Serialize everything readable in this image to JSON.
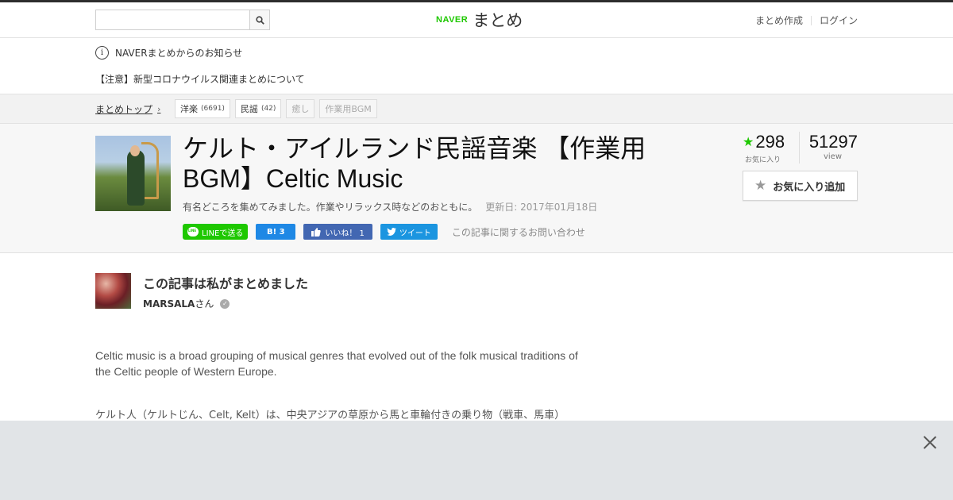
{
  "header": {
    "search": {
      "value": "",
      "placeholder": ""
    },
    "logo": {
      "brand": "NAVER",
      "product": "まとめ"
    },
    "links": {
      "create": "まとめ作成",
      "login": "ログイン"
    }
  },
  "notice": {
    "title": "NAVERまとめからのお知らせ",
    "link": "【注意】新型コロナウイルス関連まとめについて"
  },
  "breadcrumb": {
    "top": "まとめトップ",
    "tags": [
      {
        "label": "洋楽",
        "count": "(6691)"
      },
      {
        "label": "民謡",
        "count": "(42)"
      },
      {
        "label": "癒し",
        "count": ""
      },
      {
        "label": "作業用BGM",
        "count": ""
      }
    ]
  },
  "article": {
    "title": "ケルト・アイルランド民謡音楽 【作業用BGM】Celtic Music",
    "description": "有名どころを集めてみました。作業やリラックス時などのおともに。",
    "updated": "更新日: 2017年01月18日",
    "favorites": "298",
    "favorites_label": "お気に入り",
    "views": "51297",
    "views_label": "view",
    "fav_button": "お気に入り追加"
  },
  "share": {
    "line": "LINEで送る",
    "hatena": "B! 3",
    "like": "いいね！ 1",
    "tweet": "ツイート",
    "inquiry": "この記事に関するお問い合わせ"
  },
  "author": {
    "heading": "この記事は私がまとめました",
    "name": "MARSALA",
    "suffix": "さん"
  },
  "content": {
    "para1": "Celtic music is a broad grouping of musical genres that evolved out of the folk musical traditions of the Celtic people of Western Europe.",
    "para2": "ケルト人（ケルトじん、Celt, Kelt）は、中央アジアの草原から馬と車輪付きの乗り物（戦車、馬車）"
  },
  "colors": {
    "accent": "#1ec800",
    "facebook": "#4267b2",
    "twitter": "#1b95e0",
    "hatena": "#1e88e5"
  },
  "icons": [
    "search-icon",
    "info-icon",
    "chevron-right-icon",
    "star-icon",
    "line-icon",
    "facebook-like-icon",
    "twitter-icon",
    "verified-icon",
    "close-icon"
  ]
}
